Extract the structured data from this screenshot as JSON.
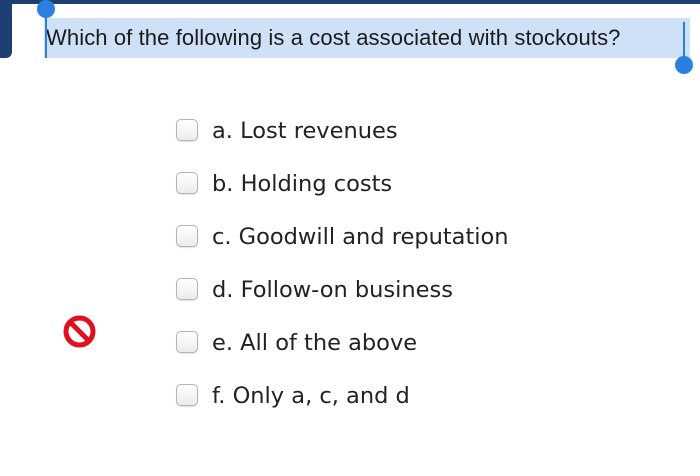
{
  "question": {
    "text": "Which of the following is a cost associated with stockouts?"
  },
  "options": [
    {
      "label": "a. Lost revenues"
    },
    {
      "label": "b. Holding costs"
    },
    {
      "label": "c. Goodwill and reputation"
    },
    {
      "label": "d. Follow-on business"
    },
    {
      "label": "e. All of the above"
    },
    {
      "label": "f. Only a, c, and d"
    }
  ],
  "feedback": {
    "icon": "prohibited-icon",
    "color": "#e0101e"
  },
  "colors": {
    "selection_highlight": "#cfe1f7",
    "selection_handles": "#2b7fe0",
    "header_bar": "#1e3f73"
  }
}
